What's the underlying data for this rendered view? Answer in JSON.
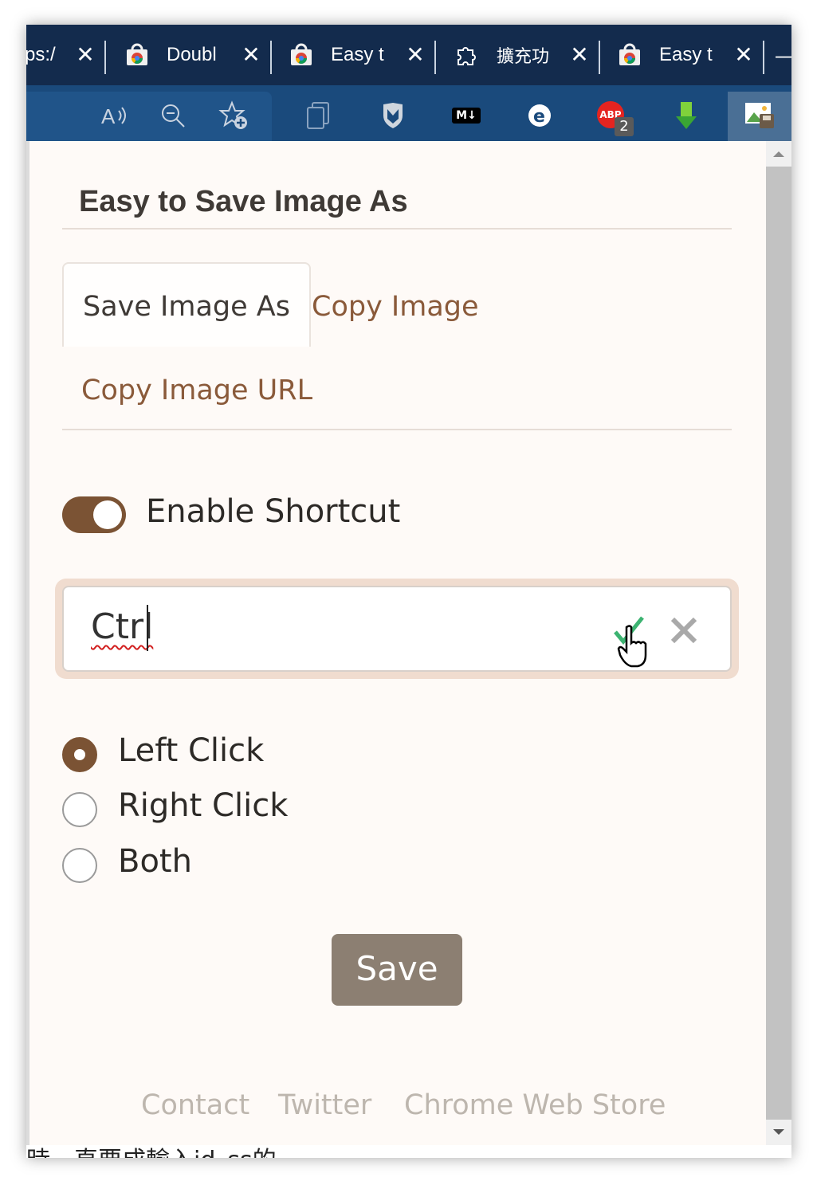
{
  "browser": {
    "tabs": [
      {
        "title": "ps:/",
        "has_favicon": false
      },
      {
        "title": "Doubl",
        "has_favicon": true,
        "favicon": "web-store-icon"
      },
      {
        "title": "Easy t",
        "has_favicon": true,
        "favicon": "web-store-icon"
      },
      {
        "title": "擴充功",
        "has_favicon": true,
        "favicon": "extension-puzzle-icon"
      },
      {
        "title": "Easy t",
        "has_favicon": true,
        "favicon": "web-store-icon"
      }
    ],
    "close_glyph": "✕",
    "new_tab_glyph": "—",
    "toolbar_icons": [
      "read-aloud-icon",
      "zoom-out-icon",
      "add-favorite-icon",
      "collections-icon",
      "mcafee-icon",
      "markdown-icon",
      "edge-extension-icon",
      "adblock-icon",
      "download-arrow-icon",
      "save-image-icon"
    ],
    "markdown_label": "M↓",
    "adblock_label": "ABP",
    "adblock_badge": "2",
    "accent": "#132b4d"
  },
  "popup": {
    "title": "Easy to Save Image As",
    "tabs": [
      {
        "label": "Save Image As",
        "active": true
      },
      {
        "label": "Copy Image",
        "active": false
      },
      {
        "label": "Copy Image URL",
        "active": false
      }
    ],
    "shortcut_toggle": {
      "label": "Enable Shortcut",
      "on": true
    },
    "shortcut_input": {
      "value": "Ctrl",
      "confirm_icon": "check-icon",
      "clear_icon": "close-icon"
    },
    "click_options": [
      {
        "label": "Left Click",
        "checked": true
      },
      {
        "label": "Right Click",
        "checked": false
      },
      {
        "label": "Both",
        "checked": false
      }
    ],
    "save_label": "Save",
    "footer_links": [
      "Contact",
      "Twitter",
      "Chrome Web Store"
    ],
    "brand_color": "#7b5334"
  },
  "background_text": "時，直要成輸入id_ss的"
}
